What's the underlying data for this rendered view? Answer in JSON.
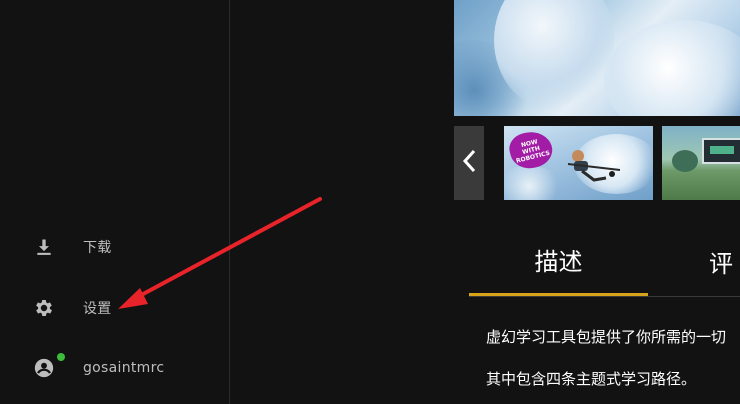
{
  "sidebar": {
    "items": [
      {
        "label": "下载",
        "icon": "download-icon"
      },
      {
        "label": "设置",
        "icon": "gear-icon"
      }
    ],
    "user": {
      "name": "gosaintmrc",
      "icon": "account-circle-icon",
      "status": "online"
    }
  },
  "main": {
    "carousel": {
      "thumbnails": [
        {
          "badge": "NOW WITH ROBOTICS"
        },
        {}
      ]
    },
    "tabs": [
      {
        "label": "描述",
        "active": true
      },
      {
        "label": "评"
      }
    ],
    "description": [
      "虚幻学习工具包提供了你所需的一切",
      "其中包含四条主题式学习路径。"
    ]
  },
  "colors": {
    "background": "#121212",
    "accent": "#d6a31a",
    "status_online": "#3dbb3d",
    "annotation_arrow": "#e8232a"
  }
}
